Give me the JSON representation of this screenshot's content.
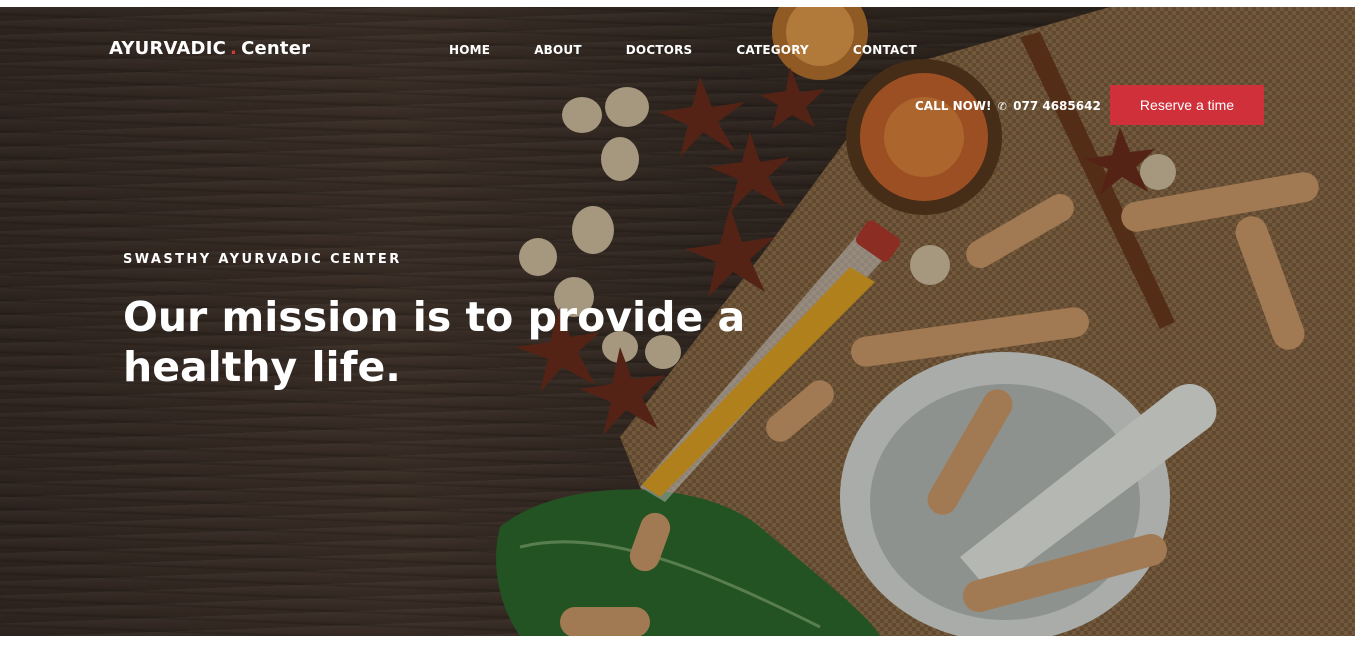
{
  "header": {
    "logo_main": "AYURVADIC",
    "logo_dot": ".",
    "logo_sub": "Center",
    "nav": [
      "HOME",
      "ABOUT",
      "DOCTORS",
      "CATEGORY",
      "CONTACT"
    ],
    "call_label": "CALL NOW!",
    "phone_icon": "phone-icon",
    "phone_symbol": "✆",
    "phone_number": "077 4685642",
    "reserve_label": "Reserve a time"
  },
  "hero": {
    "kicker": "SWASTHY AYURVADIC CENTER",
    "headline": "Our mission is to provide a healthy life."
  },
  "colors": {
    "accent": "#d0303a",
    "text": "#ffffff"
  }
}
